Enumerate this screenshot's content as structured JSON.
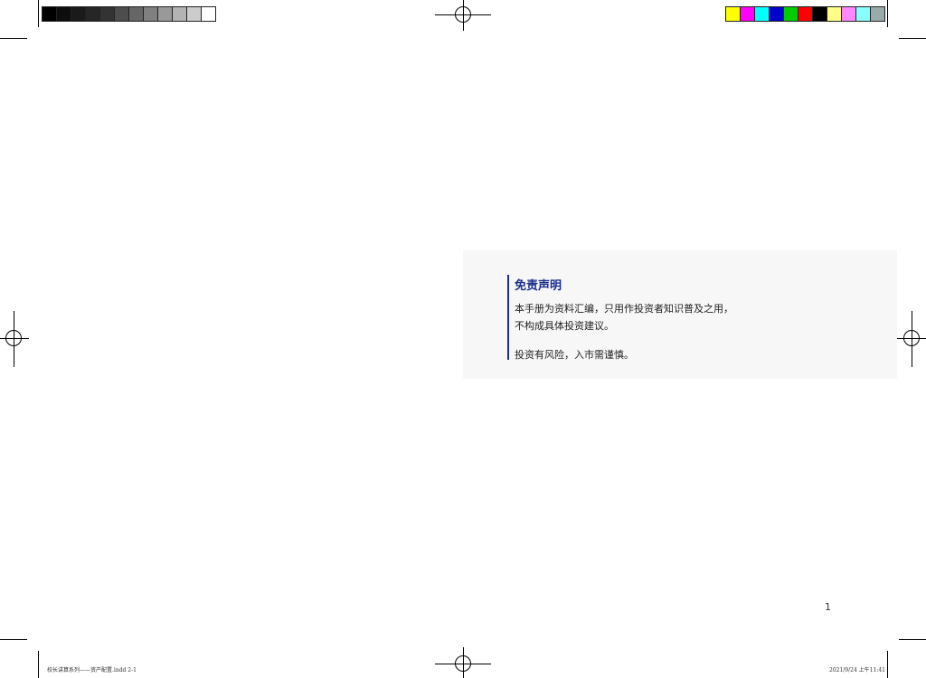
{
  "gray_swatches": [
    "#000000",
    "#0d0d0d",
    "#1a1a1a",
    "#262626",
    "#333333",
    "#4d4d4d",
    "#666666",
    "#808080",
    "#999999",
    "#b3b3b3",
    "#cccccc",
    "#ffffff"
  ],
  "color_swatches": [
    "#ffff00",
    "#ff00ff",
    "#00ffff",
    "#0000cc",
    "#00cc00",
    "#ff0000",
    "#000000",
    "#ffff88",
    "#ff88ff",
    "#88ffff",
    "#99aaaa"
  ],
  "disclaimer": {
    "title": "免责声明",
    "line1": "本手册为资料汇编，只用作投资者知识普及之用，",
    "line2": "不构成具体投资建议。",
    "line3": "投资有风险，入市需谨慎。"
  },
  "page_number": "1",
  "footer": {
    "file": "校长讲算系列——资产配置.indd 2-1",
    "date": "2021/9/24 上午11:41"
  }
}
